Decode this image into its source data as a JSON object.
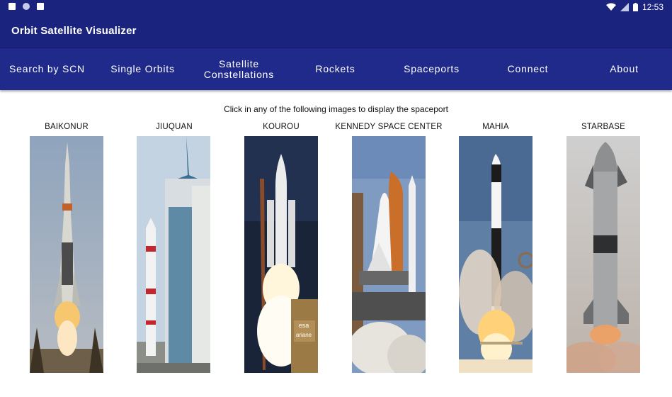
{
  "status_bar": {
    "time": "12:53",
    "left_icons": [
      "notification-a-icon",
      "circle-notification-icon",
      "sd-card-icon"
    ],
    "right_icons": [
      "wifi-icon",
      "signal-icon",
      "battery-icon"
    ]
  },
  "app": {
    "title": "Orbit Satellite Visualizer",
    "accent_color": "#1a237e"
  },
  "nav": {
    "items": [
      {
        "label": "Search by SCN"
      },
      {
        "label": "Single Orbits"
      },
      {
        "label": "Satellite\nConstellations"
      },
      {
        "label": "Rockets"
      },
      {
        "label": "Spaceports"
      },
      {
        "label": "Connect"
      },
      {
        "label": "About"
      }
    ]
  },
  "main": {
    "instruction": "Click in any of the following images to display the spaceport",
    "spaceports": [
      {
        "name": "BAIKONUR"
      },
      {
        "name": "JIUQUAN"
      },
      {
        "name": "KOUROU"
      },
      {
        "name": "KENNEDY SPACE CENTER"
      },
      {
        "name": "MAHIA"
      },
      {
        "name": "STARBASE"
      }
    ],
    "kourou_tower_text": [
      "esa",
      "ariane"
    ]
  }
}
